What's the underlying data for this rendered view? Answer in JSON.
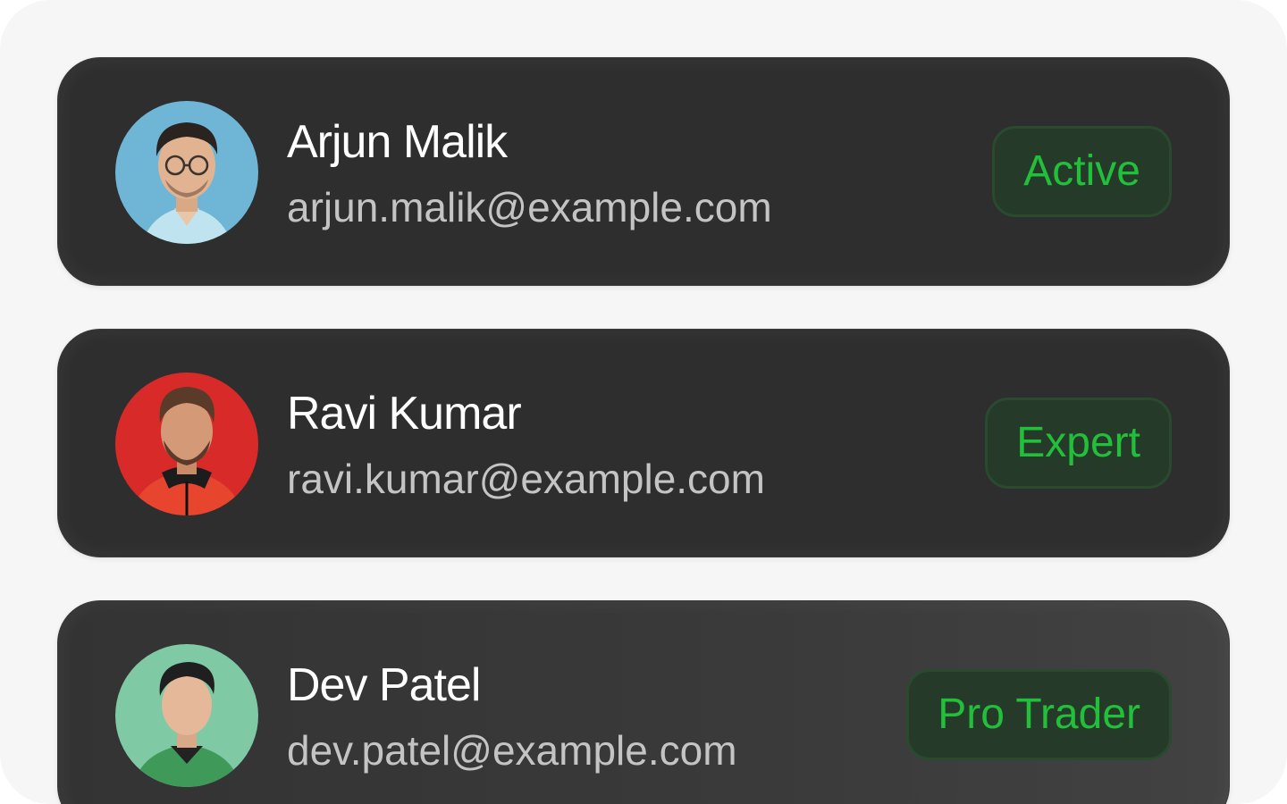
{
  "users": [
    {
      "name": "Arjun Malik",
      "email": "arjun.malik@example.com",
      "badge": "Active",
      "avatar_bg": "#6fb6d6"
    },
    {
      "name": "Ravi Kumar",
      "email": "ravi.kumar@example.com",
      "badge": "Expert",
      "avatar_bg": "#d92a2a"
    },
    {
      "name": "Dev Patel",
      "email": "dev.patel@example.com",
      "badge": "Pro Trader",
      "avatar_bg": "#7fc9a4"
    }
  ],
  "colors": {
    "card_bg": "#2e2e2e",
    "badge_text": "#22c03a",
    "badge_bg": "#263a2a",
    "name_text": "#ffffff",
    "email_text": "#c4c4c4"
  }
}
